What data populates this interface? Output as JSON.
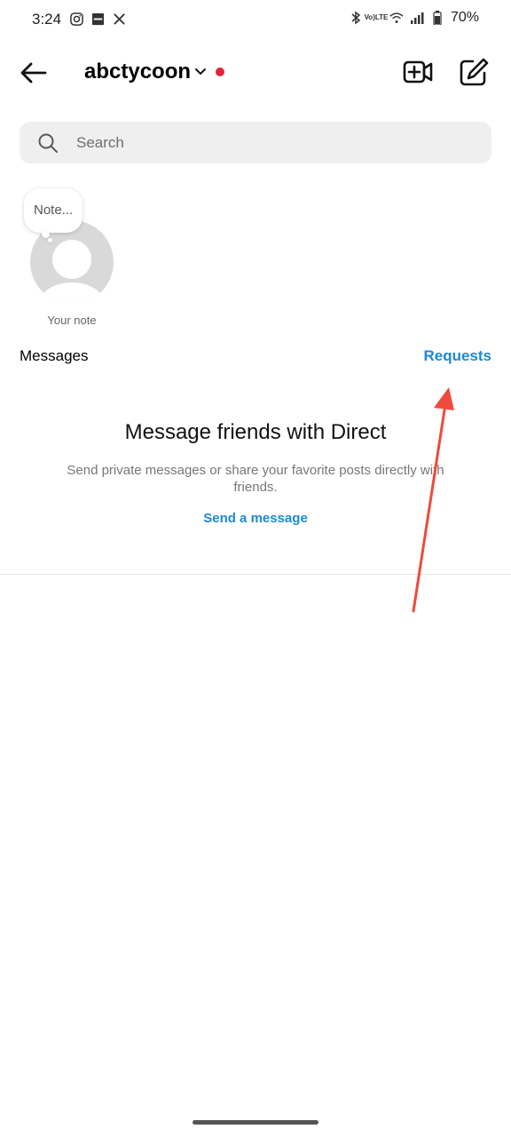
{
  "status_bar": {
    "time": "3:24",
    "battery": "70%",
    "left_icons": [
      "instagram-icon",
      "minus-box-icon",
      "x-icon"
    ],
    "right_icons": [
      "bluetooth-icon",
      "volte-icon",
      "wifi-icon",
      "signal-icon",
      "battery-icon"
    ],
    "volte_top": "Vo)",
    "volte_bottom": "LTE"
  },
  "header": {
    "username": "abctycoon",
    "dot_color": "#e0243a"
  },
  "search": {
    "placeholder": "Search"
  },
  "note": {
    "bubble_text": "Note...",
    "label": "Your note"
  },
  "messages": {
    "title": "Messages",
    "requests_label": "Requests"
  },
  "empty_state": {
    "title": "Message friends with Direct",
    "subtitle": "Send private messages or share your favorite posts directly with friends.",
    "cta": "Send a message"
  },
  "colors": {
    "accent": "#1b89d4",
    "annotation_arrow": "#ef4a3c"
  }
}
